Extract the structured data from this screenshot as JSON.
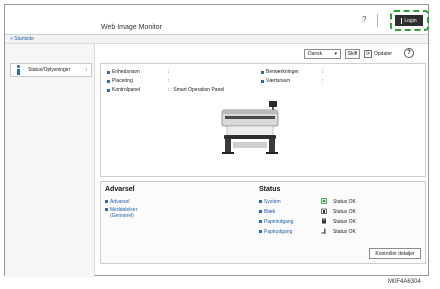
{
  "header": {
    "app_title": "Web Image Monitor",
    "help_label": "?",
    "login_label": "Login"
  },
  "breadcrumb": {
    "home_label": "« Startside"
  },
  "sidebar": {
    "items": [
      {
        "label": "Status/Oplysninger"
      }
    ]
  },
  "toolbar": {
    "language_value": "Dansk",
    "change_label": "Skift",
    "refresh_label": "Opdater",
    "help_label": "?"
  },
  "device_info": {
    "left": [
      {
        "label": "Enhedsnavn",
        "value": ""
      },
      {
        "label": "Placering",
        "value": ""
      },
      {
        "label": "Kontrolpanel",
        "value": "Smart Operation Panel"
      }
    ],
    "right": [
      {
        "label": "Bemærkninger",
        "value": ""
      },
      {
        "label": "Værtsnavn",
        "value": ""
      }
    ]
  },
  "alerts": {
    "title": "Advarsel",
    "items": [
      "Advarsel",
      "Meddelelser\n(Gennerel)"
    ]
  },
  "status": {
    "title": "Status",
    "items": [
      {
        "label": "System",
        "value": "Status OK",
        "icon": "system-status-icon"
      },
      {
        "label": "Blæk",
        "value": "Status OK",
        "icon": "ink-icon"
      },
      {
        "label": "Papirindgang",
        "value": "Status OK",
        "icon": "paper-input-icon"
      },
      {
        "label": "Papirudgang",
        "value": "Status OK",
        "icon": "paper-output-icon"
      }
    ],
    "details_label": "Kontrollér detaljer"
  },
  "caption": "M0F4A6304",
  "colors": {
    "accent": "#3068b4",
    "callout": "#2e9f36",
    "ok": "#2e9f36"
  }
}
